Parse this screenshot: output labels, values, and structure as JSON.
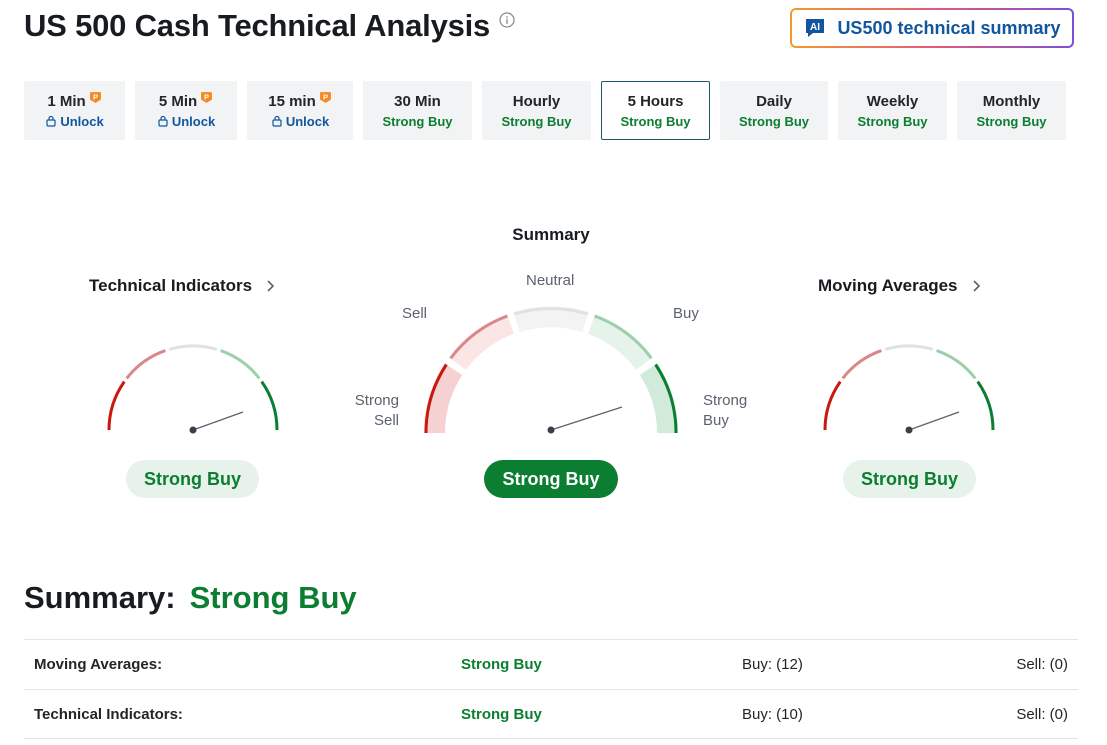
{
  "header": {
    "title": "US 500 Cash Technical Analysis",
    "ai_button_label": "US500 technical summary"
  },
  "tabs": [
    {
      "label": "1 Min",
      "status": "Unlock",
      "locked": true
    },
    {
      "label": "5 Min",
      "status": "Unlock",
      "locked": true
    },
    {
      "label": "15 min",
      "status": "Unlock",
      "locked": true
    },
    {
      "label": "30 Min",
      "status": "Strong Buy",
      "locked": false
    },
    {
      "label": "Hourly",
      "status": "Strong Buy",
      "locked": false
    },
    {
      "label": "5 Hours",
      "status": "Strong Buy",
      "locked": false,
      "active": true
    },
    {
      "label": "Daily",
      "status": "Strong Buy",
      "locked": false
    },
    {
      "label": "Weekly",
      "status": "Strong Buy",
      "locked": false
    },
    {
      "label": "Monthly",
      "status": "Strong Buy",
      "locked": false
    }
  ],
  "gauges": {
    "technical_indicators": {
      "title": "Technical Indicators",
      "result": "Strong Buy"
    },
    "summary": {
      "title": "Summary",
      "result": "Strong Buy",
      "labels": {
        "strong_sell_1": "Strong",
        "strong_sell_2": "Sell",
        "sell": "Sell",
        "neutral": "Neutral",
        "buy": "Buy",
        "strong_buy_1": "Strong",
        "strong_buy_2": "Buy"
      }
    },
    "moving_averages": {
      "title": "Moving Averages",
      "result": "Strong Buy"
    }
  },
  "summary": {
    "label": "Summary:",
    "value": "Strong Buy",
    "rows": [
      {
        "name": "Moving Averages:",
        "status": "Strong Buy",
        "buy": "Buy: (12)",
        "sell": "Sell: (0)"
      },
      {
        "name": "Technical Indicators:",
        "status": "Strong Buy",
        "buy": "Buy: (10)",
        "sell": "Sell: (0)"
      }
    ]
  },
  "colors": {
    "strong_buy": "#0b7e32",
    "strong_sell": "#c8180f",
    "link_blue": "#1256a0",
    "pro_orange": "#f5891f"
  },
  "icons": [
    "info-icon",
    "ai-icon",
    "pro-icon",
    "lock-icon",
    "chevron-right-icon"
  ]
}
